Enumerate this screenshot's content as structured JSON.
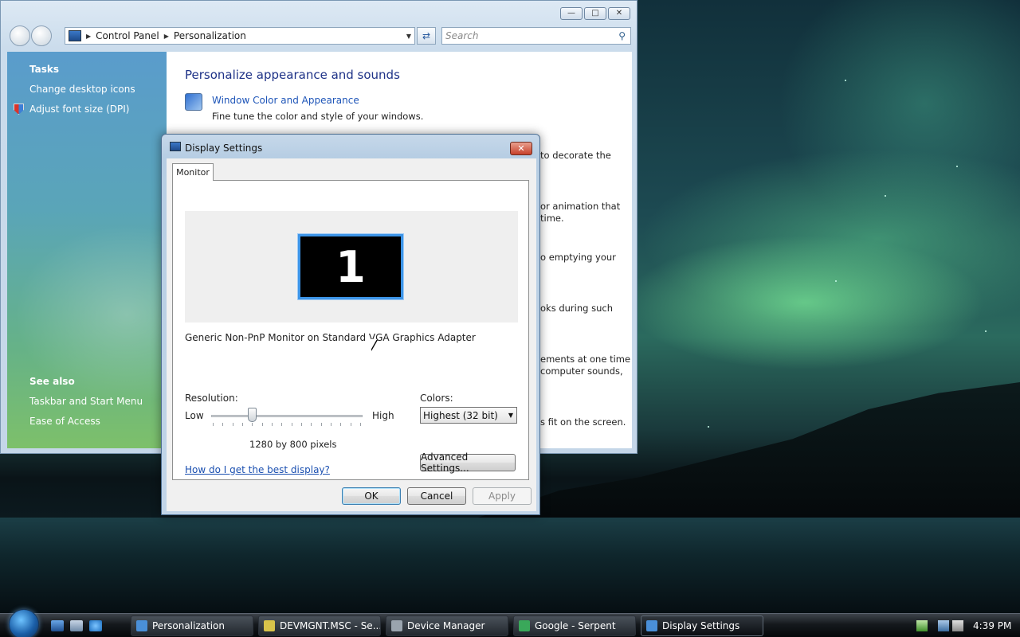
{
  "personalization_window": {
    "breadcrumb": [
      "Control Panel",
      "Personalization"
    ],
    "search_placeholder": "Search",
    "sidebar": {
      "tasks_heading": "Tasks",
      "tasks": [
        "Change desktop icons",
        "Adjust font size (DPI)"
      ],
      "see_also_heading": "See also",
      "see_also": [
        "Taskbar and Start Menu",
        "Ease of Access"
      ]
    },
    "content": {
      "title": "Personalize appearance and sounds",
      "item_link": "Window Color and Appearance",
      "item_desc": "Fine tune the color and style of your windows.",
      "fragments": [
        "to decorate the",
        "or animation that",
        "time.",
        "o emptying your",
        "oks during such",
        "ements at one time",
        "computer sounds,",
        "s fit on the screen."
      ]
    }
  },
  "display_settings": {
    "title": "Display Settings",
    "tab": "Monitor",
    "monitor_number": "1",
    "monitor_name": "Generic Non-PnP Monitor on Standard VGA Graphics Adapter",
    "resolution_label": "Resolution:",
    "low_label": "Low",
    "high_label": "High",
    "resolution_value": "1280 by 800 pixels",
    "resolution_slider_fraction": 0.27,
    "colors_label": "Colors:",
    "colors_value": "Highest (32 bit)",
    "help_link": "How do I get the best display?",
    "advanced_button": "Advanced Settings...",
    "ok_button": "OK",
    "cancel_button": "Cancel",
    "apply_button": "Apply"
  },
  "taskbar": {
    "buttons": [
      {
        "label": "Personalization",
        "icon": "personalization-icon",
        "color": "#4a8fd8"
      },
      {
        "label": "DEVMGNT.MSC - Se...",
        "icon": "notepad-icon",
        "color": "#d8c34a"
      },
      {
        "label": "Device Manager",
        "icon": "device-manager-icon",
        "color": "#9aa4ae"
      },
      {
        "label": "Google - Serpent",
        "icon": "browser-icon",
        "color": "#3aa85a"
      },
      {
        "label": "Display Settings",
        "icon": "display-settings-icon",
        "color": "#4a8fd8"
      }
    ],
    "clock": "4:39 PM"
  }
}
